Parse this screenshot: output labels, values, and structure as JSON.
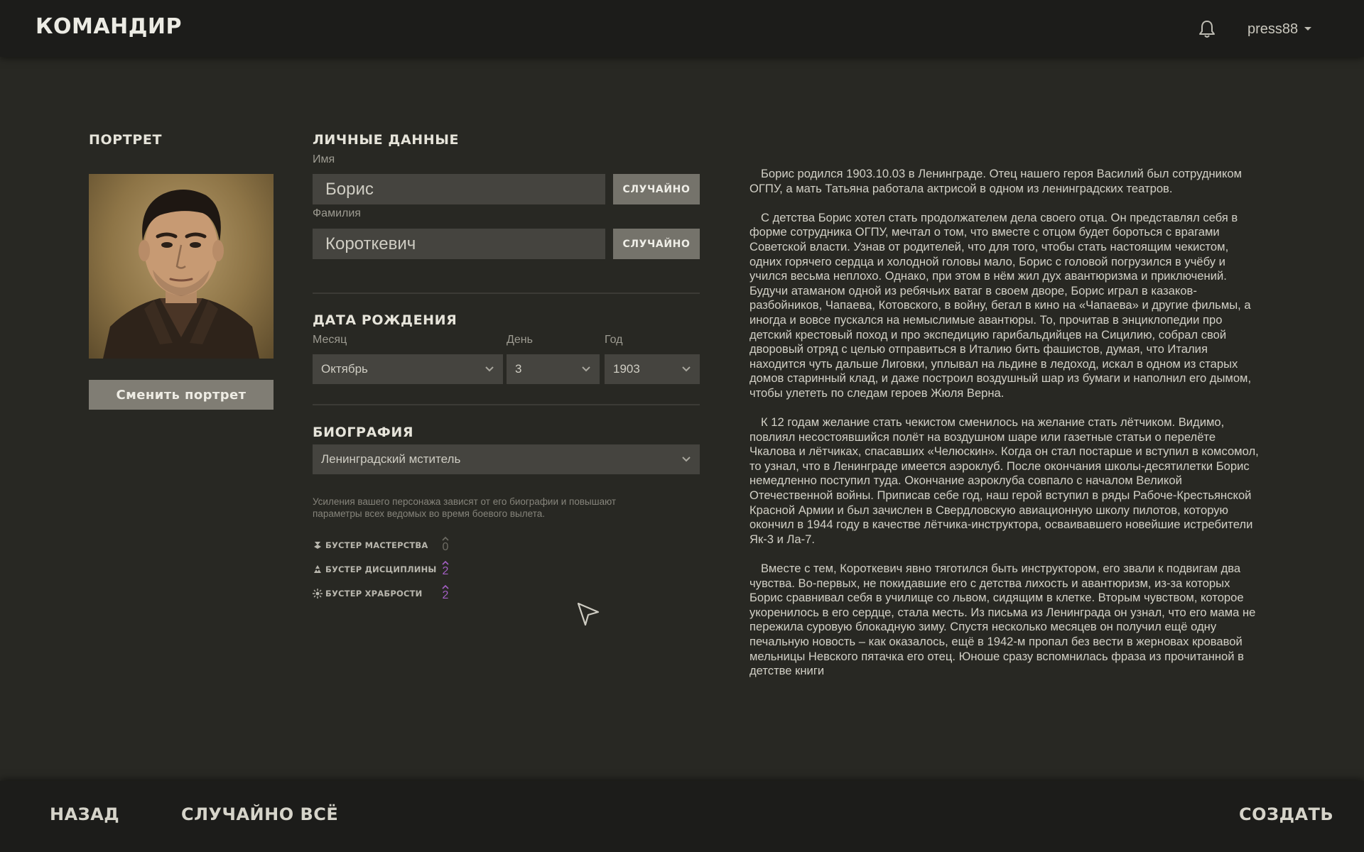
{
  "header": {
    "title": "КОМАНДИР",
    "username": "press88"
  },
  "portrait": {
    "heading": "ПОРТРЕТ",
    "change_button": "Сменить портрет"
  },
  "personal": {
    "heading": "ЛИЧНЫЕ ДАННЫЕ",
    "first_name_label": "Имя",
    "first_name_value": "Борис",
    "last_name_label": "Фамилия",
    "last_name_value": "Короткевич",
    "random_label": "СЛУЧАЙНО"
  },
  "birth": {
    "heading": "ДАТА РОЖДЕНИЯ",
    "month_label": "Месяц",
    "month_value": "Октябрь",
    "day_label": "День",
    "day_value": "3",
    "year_label": "Год",
    "year_value": "1903"
  },
  "biography": {
    "heading": "БИОГРАФИЯ",
    "selected": "Ленинградский мститель",
    "hint": "Усиления вашего персонажа зависят от его биографии и повышают параметры всех ведомых во время боевого вылета.",
    "boosters": [
      {
        "label": "БУСТЕР МАСТЕРСТВА",
        "value": "0",
        "icon": "mastery-icon",
        "color": "#6e6c64"
      },
      {
        "label": "БУСТЕР ДИСЦИПЛИНЫ",
        "value": "2",
        "icon": "discipline-icon",
        "color": "#a35fc4"
      },
      {
        "label": "БУСТЕР ХРАБРОСТИ",
        "value": "2",
        "icon": "bravery-icon",
        "color": "#a35fc4"
      }
    ]
  },
  "bio_text": [
    "Борис родился 1903.10.03 в Ленинграде. Отец нашего героя Василий был сотрудником ОГПУ, а мать Татьяна работала актрисой в одном из ленинградских театров.",
    "С детства Борис хотел стать продолжателем дела своего отца. Он представлял себя в форме сотрудника ОГПУ, мечтал о том, что вместе с отцом будет бороться с врагами Советской власти. Узнав от родителей, что для того, чтобы стать настоящим чекистом, одних горячего сердца и холодной головы мало, Борис с головой погрузился в учёбу и учился весьма неплохо. Однако, при этом в нём жил дух авантюризма и приключений. Будучи атаманом одной из ребячьих ватаг в своем дворе, Борис играл в казаков-разбойников, Чапаева, Котовского, в войну, бегал в кино на «Чапаева» и другие фильмы, а иногда и вовсе пускался на немыслимые авантюры. То, прочитав в энциклопедии про детский крестовый поход и про экспедицию гарибальдийцев на Сицилию, собрал свой дворовый отряд с целью отправиться в Италию бить фашистов, думая, что Италия находится чуть дальше Лиговки, уплывал на льдине в ледоход, искал в одном из старых домов старинный клад, и даже построил воздушный шар из бумаги и наполнил его дымом, чтобы улететь по следам героев Жюля Верна.",
    "К 12 годам желание стать чекистом сменилось на желание стать лётчиком. Видимо, повлиял несостоявшийся полёт на воздушном шаре или газетные статьи о перелёте Чкалова и лётчиках, спасавших «Челюскин». Когда он стал постарше и вступил в комсомол, то узнал, что в Ленинграде имеется аэроклуб. После окончания школы-десятилетки Борис немедленно поступил туда. Окончание аэроклуба совпало с началом Великой Отечественной войны. Приписав себе год, наш герой вступил в ряды Рабоче-Крестьянской Красной Армии и был зачислен в Свердловскую авиационную школу пилотов, которую окончил в 1944 году в качестве лётчика-инструктора, осваивавшего новейшие истребители Як-3 и Ла-7.",
    "Вместе с тем, Короткевич явно тяготился быть инструктором, его звали к подвигам два чувства. Во-первых, не покидавшие его с детства лихость и авантюризм, из-за которых Борис сравнивал себя в училище со львом, сидящим в клетке. Вторым чувством, которое укоренилось в его сердце, стала месть. Из письма из Ленинграда он узнал, что его мама не пережила суровую блокадную зиму. Спустя несколько месяцев он получил ещё одну печальную новость – как оказалось, ещё в 1942-м пропал без вести в жерновах кровавой мельницы Невского пятачка его отец. Юноше сразу вспомнилась фраза из прочитанной в детстве книги"
  ],
  "footer": {
    "back": "НАЗАД",
    "random_all": "СЛУЧАЙНО ВСЁ",
    "create": "СОЗДАТЬ"
  }
}
